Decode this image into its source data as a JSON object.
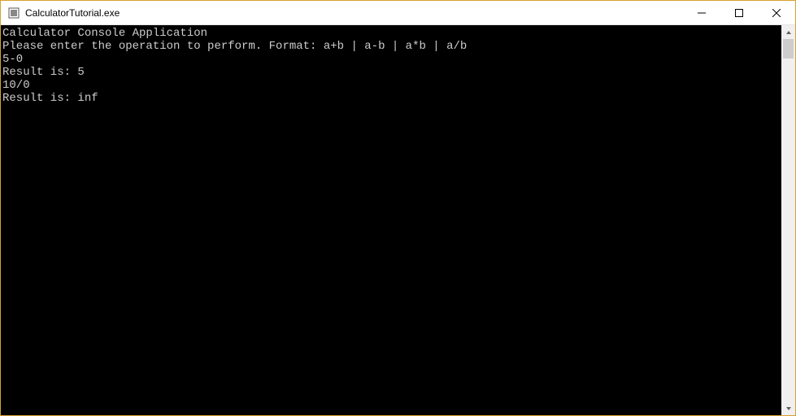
{
  "window": {
    "title": "CalculatorTutorial.exe"
  },
  "console": {
    "lines": [
      "Calculator Console Application",
      "",
      "Please enter the operation to perform. Format: a+b | a-b | a*b | a/b",
      "5-0",
      "Result is: 5",
      "10/0",
      "Result is: inf"
    ]
  }
}
